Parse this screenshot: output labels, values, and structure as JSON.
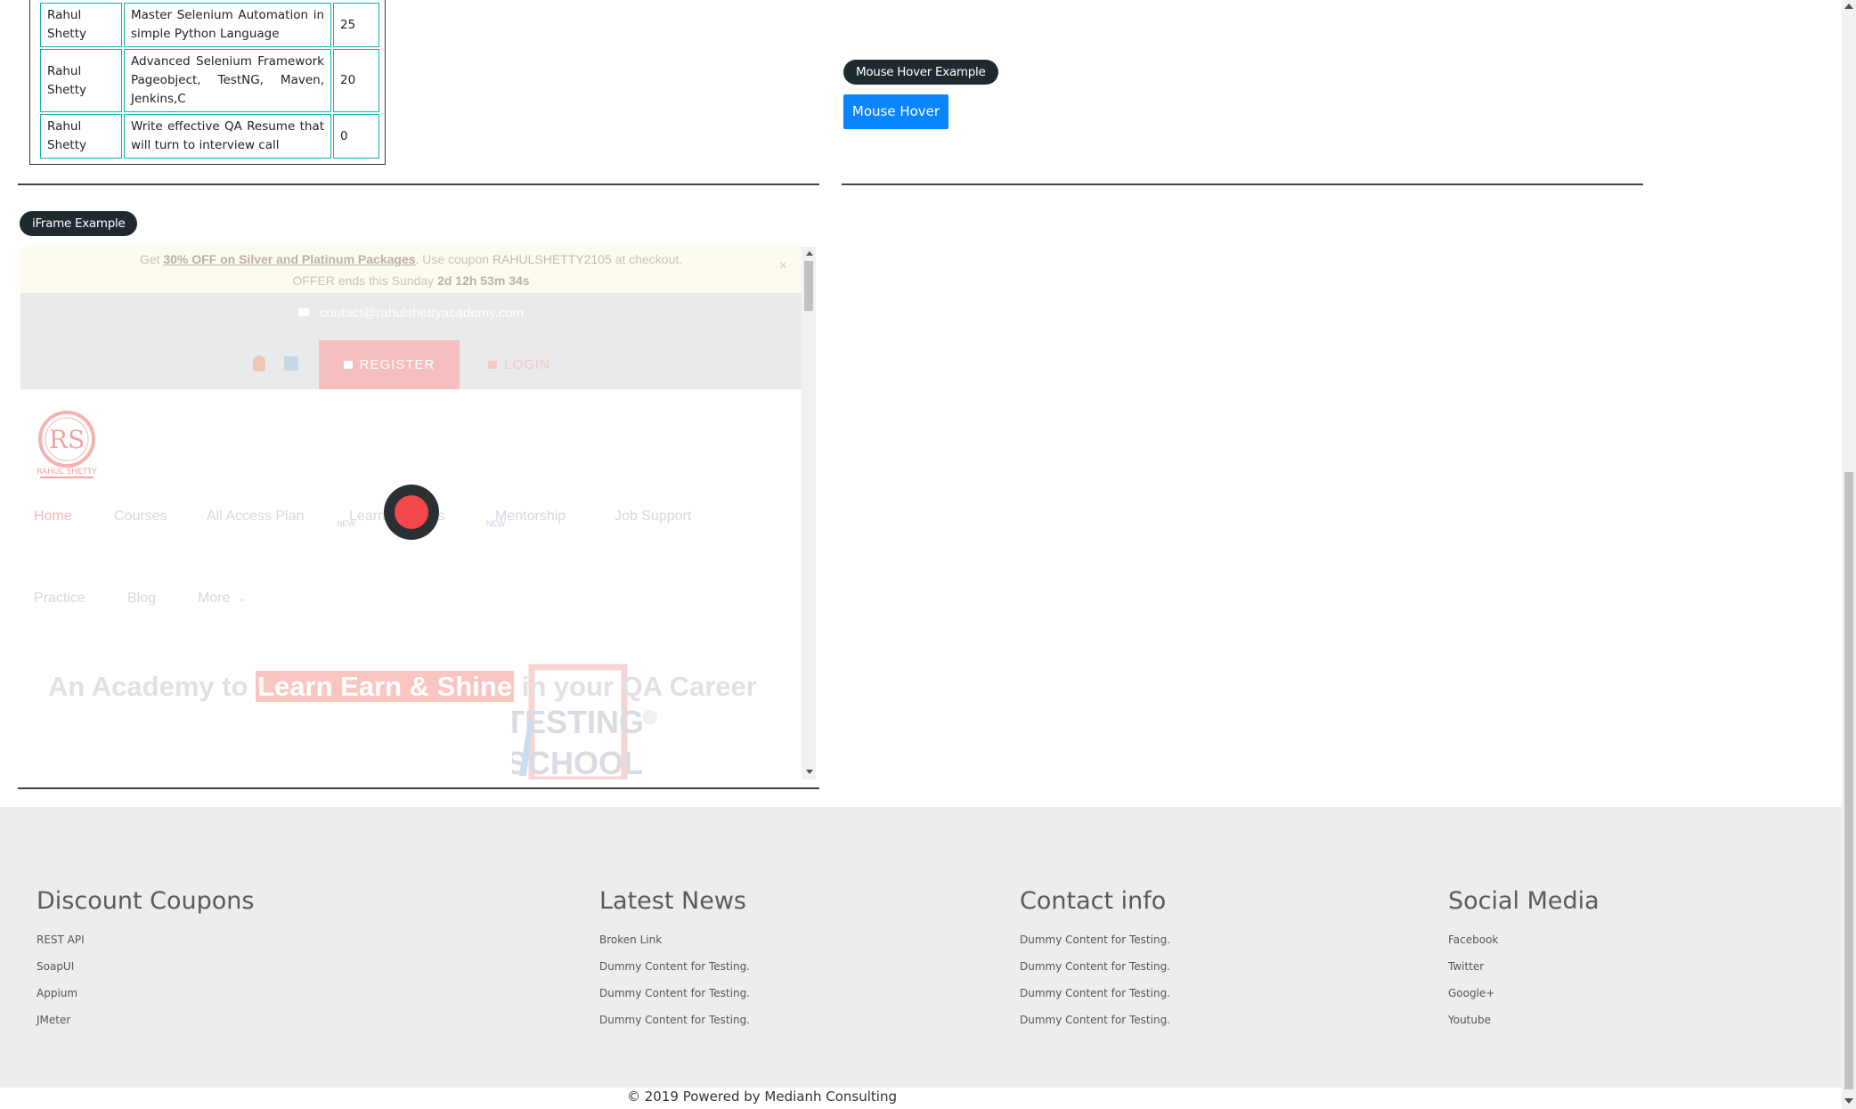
{
  "table": {
    "rows": [
      {
        "instructor": "Rahul Shetty",
        "course": "Master Selenium Automation in simple Python Language",
        "price": "25"
      },
      {
        "instructor": "Rahul Shetty",
        "course": "Advanced Selenium Framework Pageobject, TestNG, Maven, Jenkins,C",
        "price": "20"
      },
      {
        "instructor": "Rahul Shetty",
        "course": "Write effective QA Resume that will turn to interview call",
        "price": "0"
      }
    ]
  },
  "mouse_hover": {
    "legend": "Mouse Hover Example",
    "button_label": "Mouse Hover"
  },
  "iframe": {
    "legend": "iFrame Example",
    "promo": {
      "prefix": "Get ",
      "offer": "30% OFF on Silver and Platinum Packages",
      "middle": ". Use coupon ",
      "code": "RAHULSHETTY2105",
      "suffix": " at checkout.",
      "ends_prefix": "OFFER ends this Sunday ",
      "timer": "2d 12h 53m 34s",
      "close": "×"
    },
    "contact_email": "contact@rahulshettyacademy.com",
    "register_label": "REGISTER",
    "login_label": "LOGIN",
    "nav_row1": {
      "home": "Home",
      "courses": "Courses",
      "all_access": "All Access Plan",
      "learning_paths": "Learning Paths",
      "mentorship": "Mentorship",
      "job_support": "Job Support",
      "new_badge": "NEW"
    },
    "nav_row2": {
      "practice": "Practice",
      "blog": "Blog",
      "more": "More",
      "more_chevron": "⌄"
    },
    "hero": {
      "before": "An Academy to ",
      "highlight": "Learn Earn & Shine",
      "after": " in your QA Career"
    },
    "logo_text": "RAHUL SHETTY",
    "hero_logo_text_1": "TESTING",
    "hero_logo_text_2": "SCHOOL"
  },
  "footer": {
    "coupons": {
      "heading": "Discount Coupons",
      "links": [
        "REST API",
        "SoapUI",
        "Appium",
        "JMeter"
      ]
    },
    "news": {
      "heading": "Latest News",
      "links": [
        "Broken Link",
        "Dummy Content for Testing.",
        "Dummy Content for Testing.",
        "Dummy Content for Testing."
      ]
    },
    "contact": {
      "heading": "Contact info",
      "links": [
        "Dummy Content for Testing.",
        "Dummy Content for Testing.",
        "Dummy Content for Testing.",
        "Dummy Content for Testing."
      ]
    },
    "social": {
      "heading": "Social Media",
      "links": [
        "Facebook",
        "Twitter",
        "Google+",
        "Youtube"
      ]
    }
  },
  "copyright": {
    "prefix": "© 2019 Powered by ",
    "brand": "Medianh Consulting"
  },
  "colors": {
    "badge_bg": "#1f2a2f",
    "hover_button": "#0a84ff",
    "table_border": "#11aebb",
    "loader_red": "#f4474a",
    "footer_bg": "#ededed"
  }
}
